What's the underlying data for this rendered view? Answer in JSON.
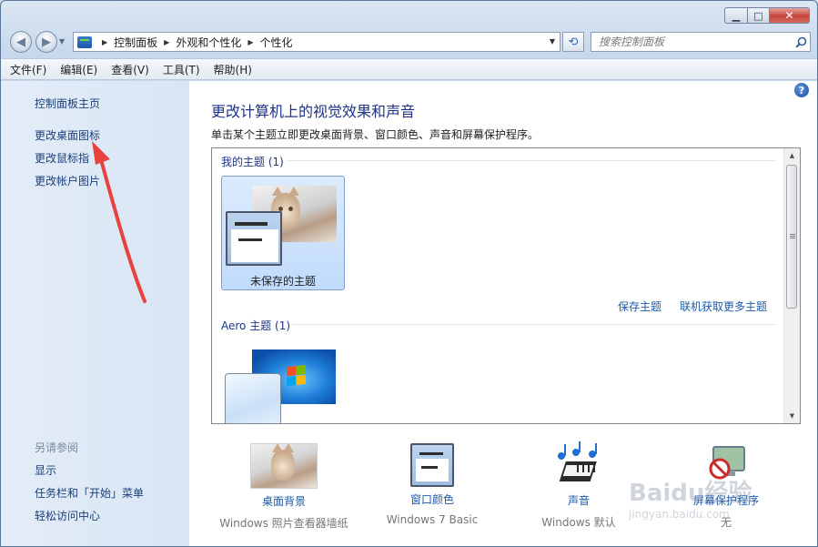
{
  "window": {
    "caption": {
      "minimize": "▁",
      "maximize": "□",
      "close": "✕"
    }
  },
  "nav": {
    "back": "◀",
    "forward": "▶",
    "history_dropdown": "▼"
  },
  "address": {
    "crumbs": [
      "控制面板",
      "外观和个性化",
      "个性化"
    ],
    "separator": "▶",
    "dropdown": "▼"
  },
  "refresh": {
    "glyph": "⟲"
  },
  "search": {
    "placeholder": "搜索控制面板"
  },
  "menubar": [
    "文件(F)",
    "编辑(E)",
    "查看(V)",
    "工具(T)",
    "帮助(H)"
  ],
  "sidebar": {
    "home": "控制面板主页",
    "links": [
      "更改桌面图标",
      "更改鼠标指",
      "更改帐户图片"
    ],
    "see_also_title": "另请参阅",
    "see_also": [
      "显示",
      "任务栏和「开始」菜单",
      "轻松访问中心"
    ]
  },
  "main": {
    "help": "?",
    "title": "更改计算机上的视觉效果和声音",
    "subtitle": "单击某个主题立即更改桌面背景、窗口颜色、声音和屏幕保护程序。",
    "my_themes_header": "我的主题 (1)",
    "unsaved_theme_label": "未保存的主题",
    "save_theme": "保存主题",
    "get_more_themes": "联机获取更多主题",
    "aero_header": "Aero 主题 (1)"
  },
  "options": [
    {
      "label": "桌面背景",
      "value": "Windows 照片查看器墙纸"
    },
    {
      "label": "窗口颜色",
      "value": "Windows 7 Basic"
    },
    {
      "label": "声音",
      "value": "Windows 默认"
    },
    {
      "label": "屏幕保护程序",
      "value": "无"
    }
  ],
  "watermark": {
    "brand": "Baidu经验",
    "url": "jingyan.baidu.com"
  },
  "colors": {
    "link": "#1d5aab",
    "title": "#1e3287",
    "annotation_arrow": "#e8423f"
  }
}
